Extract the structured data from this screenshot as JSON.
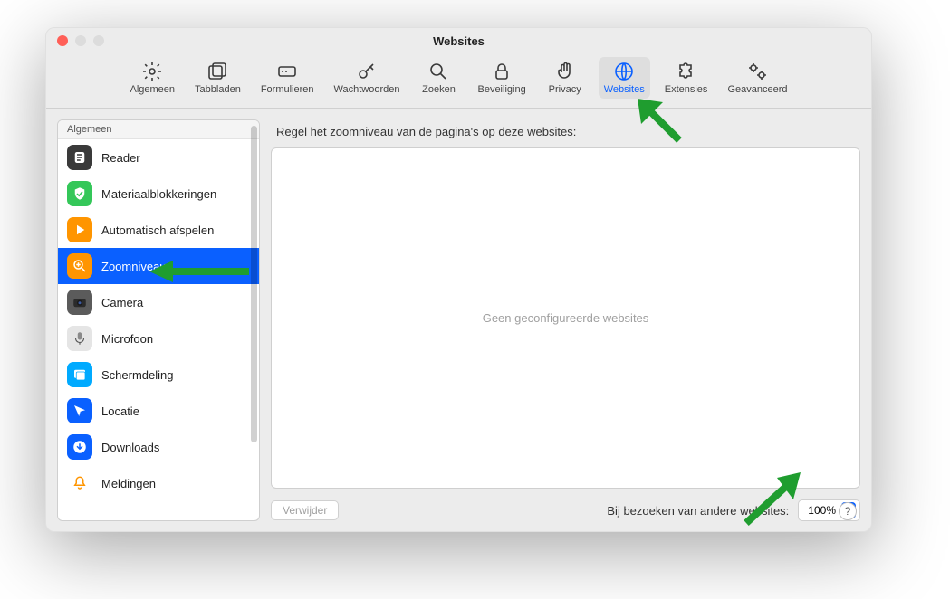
{
  "window": {
    "title": "Websites"
  },
  "toolbar": [
    {
      "id": "general",
      "label": "Algemeen",
      "icon": "gear"
    },
    {
      "id": "tabs",
      "label": "Tabbladen",
      "icon": "tabs"
    },
    {
      "id": "forms",
      "label": "Formulieren",
      "icon": "form"
    },
    {
      "id": "passwords",
      "label": "Wachtwoorden",
      "icon": "key"
    },
    {
      "id": "search",
      "label": "Zoeken",
      "icon": "search"
    },
    {
      "id": "security",
      "label": "Beveiliging",
      "icon": "lock"
    },
    {
      "id": "privacy",
      "label": "Privacy",
      "icon": "hand"
    },
    {
      "id": "websites",
      "label": "Websites",
      "icon": "globe",
      "active": true
    },
    {
      "id": "extensions",
      "label": "Extensies",
      "icon": "puzzle"
    },
    {
      "id": "advanced",
      "label": "Geavanceerd",
      "icon": "gears"
    }
  ],
  "sidebar": {
    "header": "Algemeen",
    "items": [
      {
        "id": "reader",
        "label": "Reader",
        "color": "#3a3a3a",
        "icon": "reader"
      },
      {
        "id": "blockers",
        "label": "Materiaalblokkeringen",
        "color": "#34c759",
        "icon": "shield"
      },
      {
        "id": "autoplay",
        "label": "Automatisch afspelen",
        "color": "#ff9500",
        "icon": "play"
      },
      {
        "id": "zoom",
        "label": "Zoomniveau",
        "color": "#ff9500",
        "icon": "zoom",
        "selected": true
      },
      {
        "id": "camera",
        "label": "Camera",
        "color": "#5b5b5b",
        "icon": "camera"
      },
      {
        "id": "microphone",
        "label": "Microfoon",
        "color": "#e5e5e5",
        "icon": "mic"
      },
      {
        "id": "screenshare",
        "label": "Schermdeling",
        "color": "#00aaff",
        "icon": "screen"
      },
      {
        "id": "location",
        "label": "Locatie",
        "color": "#0a60ff",
        "icon": "arrow"
      },
      {
        "id": "downloads",
        "label": "Downloads",
        "color": "#0a60ff",
        "icon": "download"
      },
      {
        "id": "notify",
        "label": "Meldingen",
        "color": "#ffffff",
        "icon": "bell"
      }
    ]
  },
  "panel": {
    "heading": "Regel het zoomniveau van de pagina's op deze websites:",
    "empty": "Geen geconfigureerde websites",
    "deleteLabel": "Verwijder",
    "footerLabel": "Bij bezoeken van andere websites:",
    "selectValue": "100%"
  },
  "help": "?"
}
